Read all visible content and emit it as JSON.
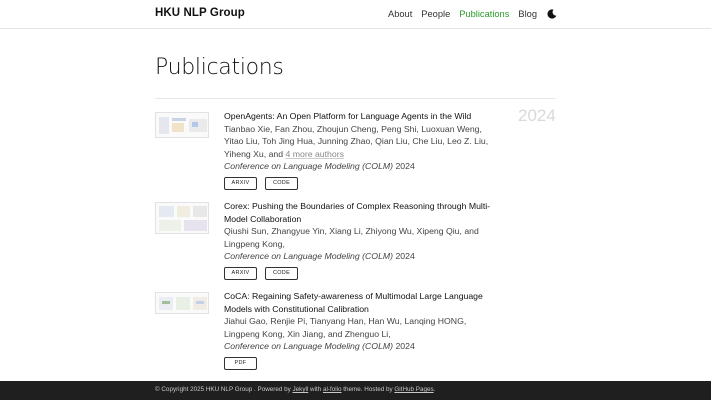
{
  "nav": {
    "brand": "HKU NLP Group",
    "items": [
      {
        "label": "About",
        "active": false
      },
      {
        "label": "People",
        "active": false
      },
      {
        "label": "Publications",
        "active": true
      },
      {
        "label": "Blog",
        "active": false
      }
    ],
    "theme_icon": "moon-icon",
    "active_color": "#2a9b2a"
  },
  "page": {
    "title": "Publications",
    "year": "2024"
  },
  "publications": [
    {
      "title": "OpenAgents: An Open Platform for Language Agents in the Wild",
      "authors": "Tianbao Xie, Fan Zhou, Zhoujun Cheng, Peng Shi, Luoxuan Weng, Yitao Liu, Toh Jing Hua, Junning Zhao, Qian Liu, Che Liu, Leo Z. Liu,  Yiheng Xu, and",
      "more_authors": "4 more authors",
      "venue": "Conference on Language Modeling (COLM)",
      "year": "2024",
      "buttons": [
        "ARXIV",
        "CODE"
      ]
    },
    {
      "title": "Corex: Pushing the Boundaries of Complex Reasoning through Multi-Model Collaboration",
      "authors": "Qiushi Sun, Zhangyue Yin, Xiang Li, Zhiyong Wu, Xipeng Qiu, and Lingpeng Kong,",
      "more_authors": "",
      "venue": "Conference on Language Modeling (COLM)",
      "year": "2024",
      "buttons": [
        "ARXIV",
        "CODE"
      ]
    },
    {
      "title": "CoCA: Regaining Safety-awareness of Multimodal Large Language Models with Constitutional Calibration",
      "authors": "Jiahui Gao, Renjie Pi, Tianyang Han, Han Wu, Lanqing HONG, Lingpeng Kong, Xin Jiang, and Zhenguo Li,",
      "more_authors": "",
      "venue": "Conference on Language Modeling (COLM)",
      "year": "2024",
      "buttons": [
        "PDF"
      ]
    }
  ],
  "footer": {
    "copyright": "© Copyright 2025 HKU NLP Group . Powered by",
    "jekyll": "Jekyll",
    "with": "with",
    "theme": "al-folio",
    "theme_suffix": "theme. Hosted by",
    "host": "GitHub Pages",
    "end": "."
  }
}
